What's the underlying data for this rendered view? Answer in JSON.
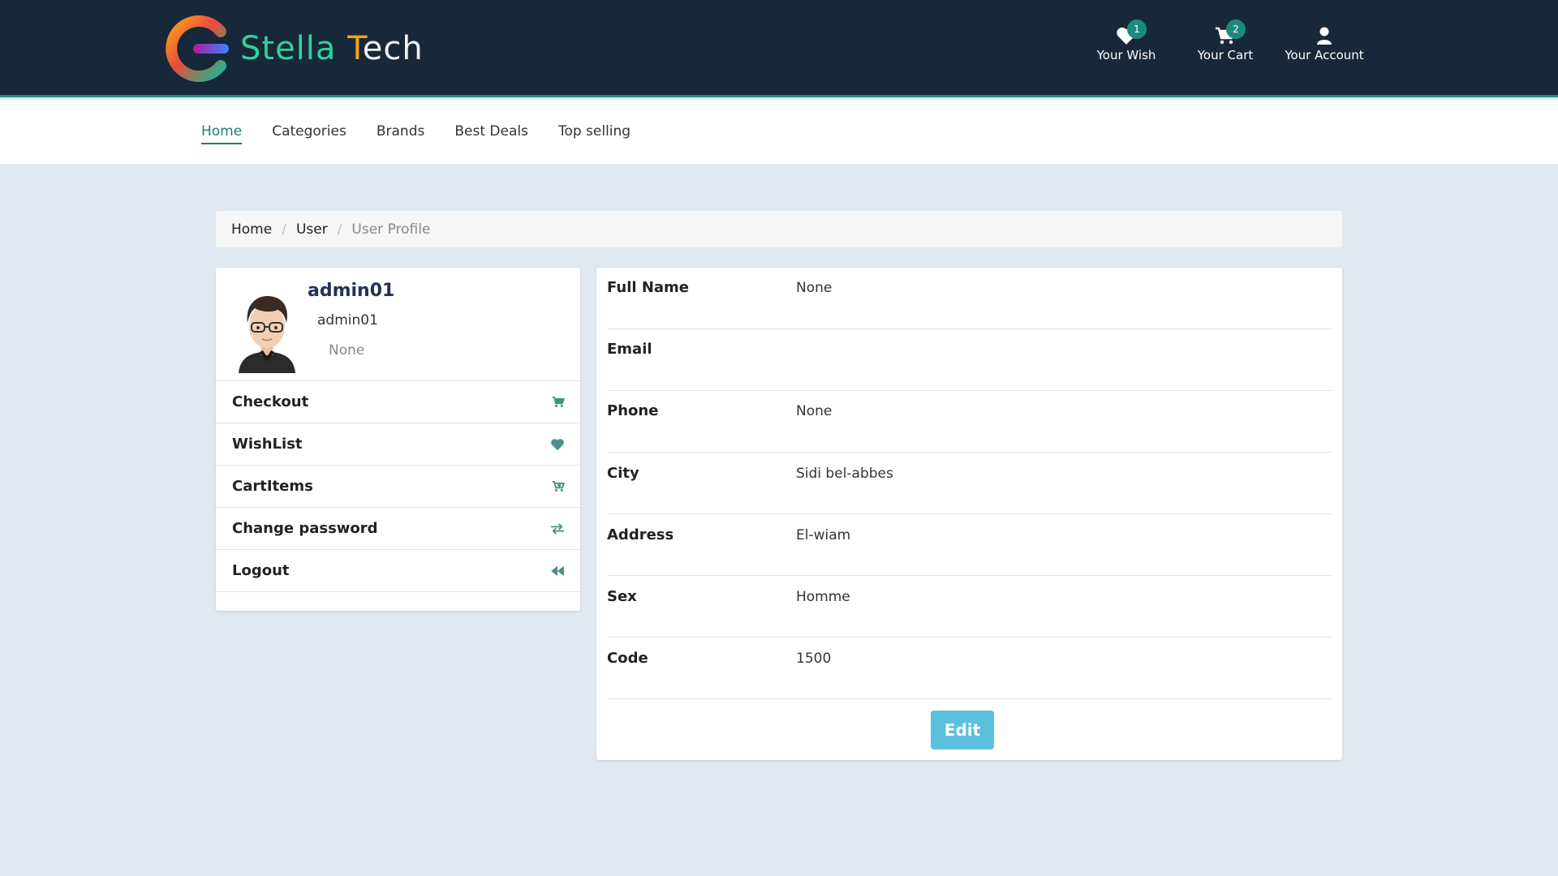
{
  "brand": {
    "name_part1": "Stella",
    "name_part2_first": "T",
    "name_part2_rest": "ech"
  },
  "header": {
    "wish": {
      "label": "Your Wish",
      "count": "1",
      "icon": "heart-icon"
    },
    "cart": {
      "label": "Your Cart",
      "count": "2",
      "icon": "cart-icon"
    },
    "account": {
      "label": "Your Account",
      "icon": "user-icon"
    }
  },
  "nav": {
    "items": [
      {
        "label": "Home",
        "active": true
      },
      {
        "label": "Categories"
      },
      {
        "label": "Brands"
      },
      {
        "label": "Best Deals"
      },
      {
        "label": "Top selling"
      }
    ]
  },
  "breadcrumb": {
    "home": "Home",
    "user": "User",
    "current": "User Profile"
  },
  "profile": {
    "name": "admin01",
    "username": "admin01",
    "extra": "None"
  },
  "side_menu": [
    {
      "label": "Checkout",
      "icon": "cart-icon"
    },
    {
      "label": "WishList",
      "icon": "heart-icon"
    },
    {
      "label": "CartItems",
      "icon": "cart-plus-icon"
    },
    {
      "label": "Change password",
      "icon": "exchange-icon"
    },
    {
      "label": "Logout",
      "icon": "backward-icon"
    }
  ],
  "details": [
    {
      "key": "Full Name",
      "value": "None"
    },
    {
      "key": "Email",
      "value": ""
    },
    {
      "key": "Phone",
      "value": "None"
    },
    {
      "key": "City",
      "value": "Sidi bel-abbes"
    },
    {
      "key": "Address",
      "value": "El-wiam"
    },
    {
      "key": "Sex",
      "value": "Homme"
    },
    {
      "key": "Code",
      "value": "1500"
    }
  ],
  "edit_label": "Edit",
  "colors": {
    "header_bg": "#16283a",
    "accent": "#1d8f82",
    "edit_button": "#5bc0de",
    "page_bg": "#e1e8f0"
  }
}
